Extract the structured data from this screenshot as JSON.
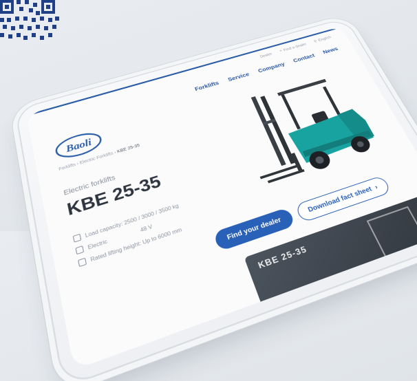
{
  "header": {
    "utility_links": [
      "Dealer",
      "Find a dealer",
      "English"
    ],
    "nav": [
      "Forklifts",
      "Service",
      "Company",
      "Contact",
      "News"
    ]
  },
  "brand": {
    "logo_text": "Baoli"
  },
  "breadcrumb": {
    "item1": "Forklifts",
    "item2": "Electric Forklifts",
    "current": "KBE 25-35"
  },
  "product": {
    "category": "Electric forklifts",
    "title": "KBE 25-35",
    "specs": [
      {
        "label": "Load capacity: 2500 / 3000 / 3500 kg",
        "extra": ""
      },
      {
        "label": "Electric",
        "extra": "48 V"
      },
      {
        "label": "Rated lifting height: Up to 6000 mm",
        "extra": ""
      }
    ]
  },
  "actions": {
    "find_dealer": "Find your dealer",
    "download": "Download fact sheet"
  },
  "video": {
    "title": "KBE 25-35"
  },
  "colors": {
    "brand_blue": "#2960b8",
    "forklift_teal": "#19a3a0"
  }
}
